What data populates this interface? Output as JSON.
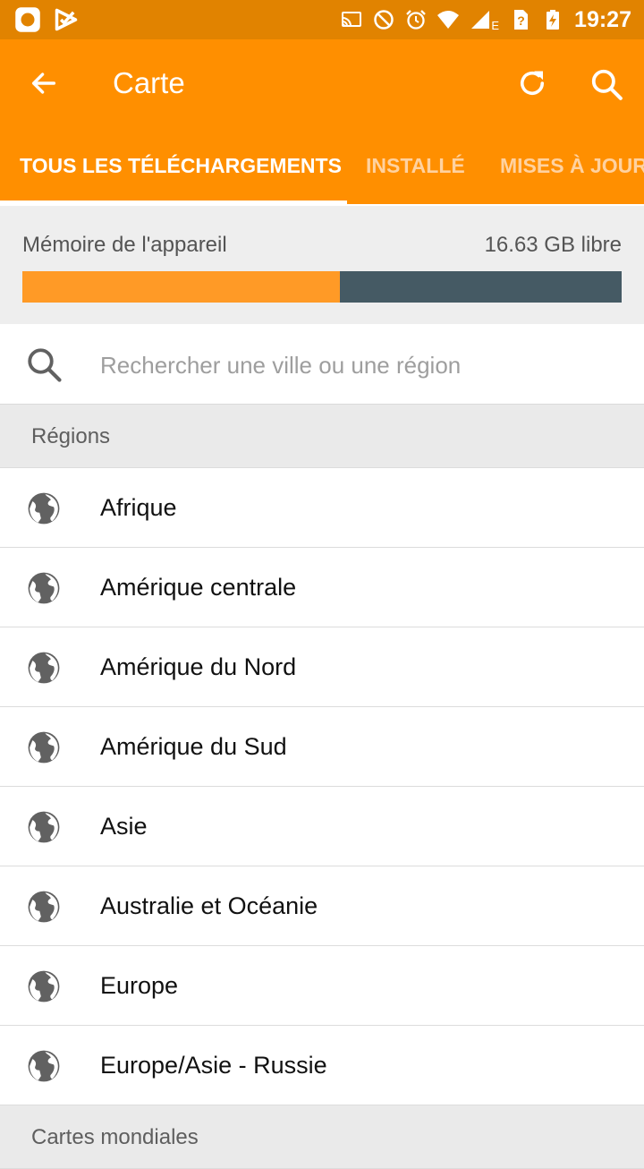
{
  "status_bar": {
    "time": "19:27",
    "network_label": "E",
    "icons": [
      "notification-app-icon",
      "notification-check-icon",
      "cast-icon",
      "do-not-disturb-icon",
      "alarm-icon",
      "wifi-icon",
      "signal-icon",
      "sim-unknown-icon",
      "battery-charging-icon"
    ]
  },
  "appbar": {
    "title": "Carte",
    "back_icon": "arrow-back-icon",
    "refresh_icon": "refresh-icon",
    "search_icon": "search-icon",
    "color": "#ff8f00"
  },
  "tabs": [
    {
      "label": "TOUS LES TÉLÉCHARGEMENTS",
      "selected": true
    },
    {
      "label": "INSTALLÉ",
      "selected": false
    },
    {
      "label": "MISES À JOUR",
      "selected": false
    }
  ],
  "storage": {
    "label": "Mémoire de l'appareil",
    "free": "16.63 GB libre",
    "used_fraction": 0.53,
    "used_color": "#ff9a26",
    "free_color": "#455a64"
  },
  "search": {
    "placeholder": "Rechercher une ville ou une région",
    "value": ""
  },
  "sections": {
    "regions": "Régions",
    "world_maps": "Cartes mondiales"
  },
  "regions": [
    {
      "label": "Afrique",
      "icon": "globe-icon"
    },
    {
      "label": "Amérique centrale",
      "icon": "globe-icon"
    },
    {
      "label": "Amérique du Nord",
      "icon": "globe-icon"
    },
    {
      "label": "Amérique du Sud",
      "icon": "globe-icon"
    },
    {
      "label": "Asie",
      "icon": "globe-icon"
    },
    {
      "label": "Australie et Océanie",
      "icon": "globe-icon"
    },
    {
      "label": "Europe",
      "icon": "globe-icon"
    },
    {
      "label": "Europe/Asie - Russie",
      "icon": "globe-icon"
    }
  ]
}
